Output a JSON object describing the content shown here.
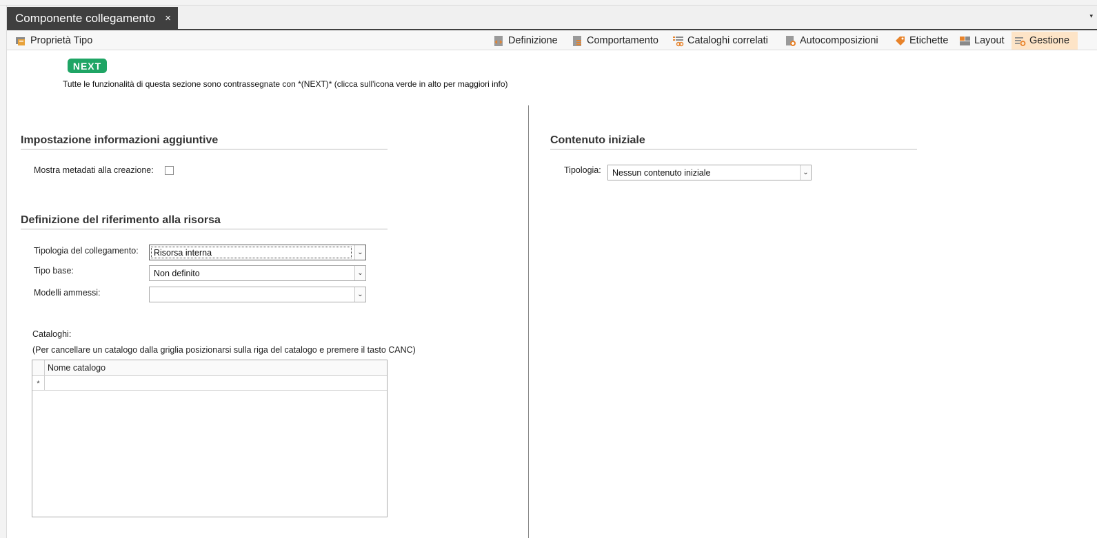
{
  "tab": {
    "title": "Componente collegamento",
    "close": "×",
    "dropdown": "▾"
  },
  "toolbar": {
    "left_item": "Proprietà Tipo",
    "items": [
      {
        "label": "Definizione"
      },
      {
        "label": "Comportamento"
      },
      {
        "label": "Cataloghi correlati"
      },
      {
        "label": "Autocomposizioni"
      },
      {
        "label": "Etichette"
      },
      {
        "label": "Layout"
      },
      {
        "label": "Gestione",
        "active": true
      }
    ],
    "accent_color": "#fde4c7"
  },
  "next": {
    "badge": "NEXT",
    "badge_color": "#1fa565",
    "info": "Tutte le funzionalità di questa sezione sono contrassegnate con *(NEXT)* (clicca sull'icona verde in alto per maggiori info)"
  },
  "additional_info": {
    "title": "Impostazione informazioni aggiuntive",
    "show_metadata_label": "Mostra metadati alla creazione:",
    "show_metadata_checked": false
  },
  "resource_ref": {
    "title": "Definizione del riferimento alla risorsa",
    "link_type_label": "Tipologia del collegamento:",
    "link_type_value": "Risorsa interna",
    "base_type_label": "Tipo base:",
    "base_type_value": "Non definito",
    "models_label": "Modelli ammessi:",
    "models_value": "",
    "catalogs_label": "Cataloghi:",
    "catalogs_hint": "(Per cancellare un catalogo dalla griglia posizionarsi sulla riga del catalogo e premere il tasto CANC)",
    "grid_column": "Nome catalogo",
    "new_row_marker": "*"
  },
  "initial_content": {
    "title": "Contenuto iniziale",
    "type_label": "Tipologia:",
    "type_value": "Nessun contenuto iniziale"
  }
}
